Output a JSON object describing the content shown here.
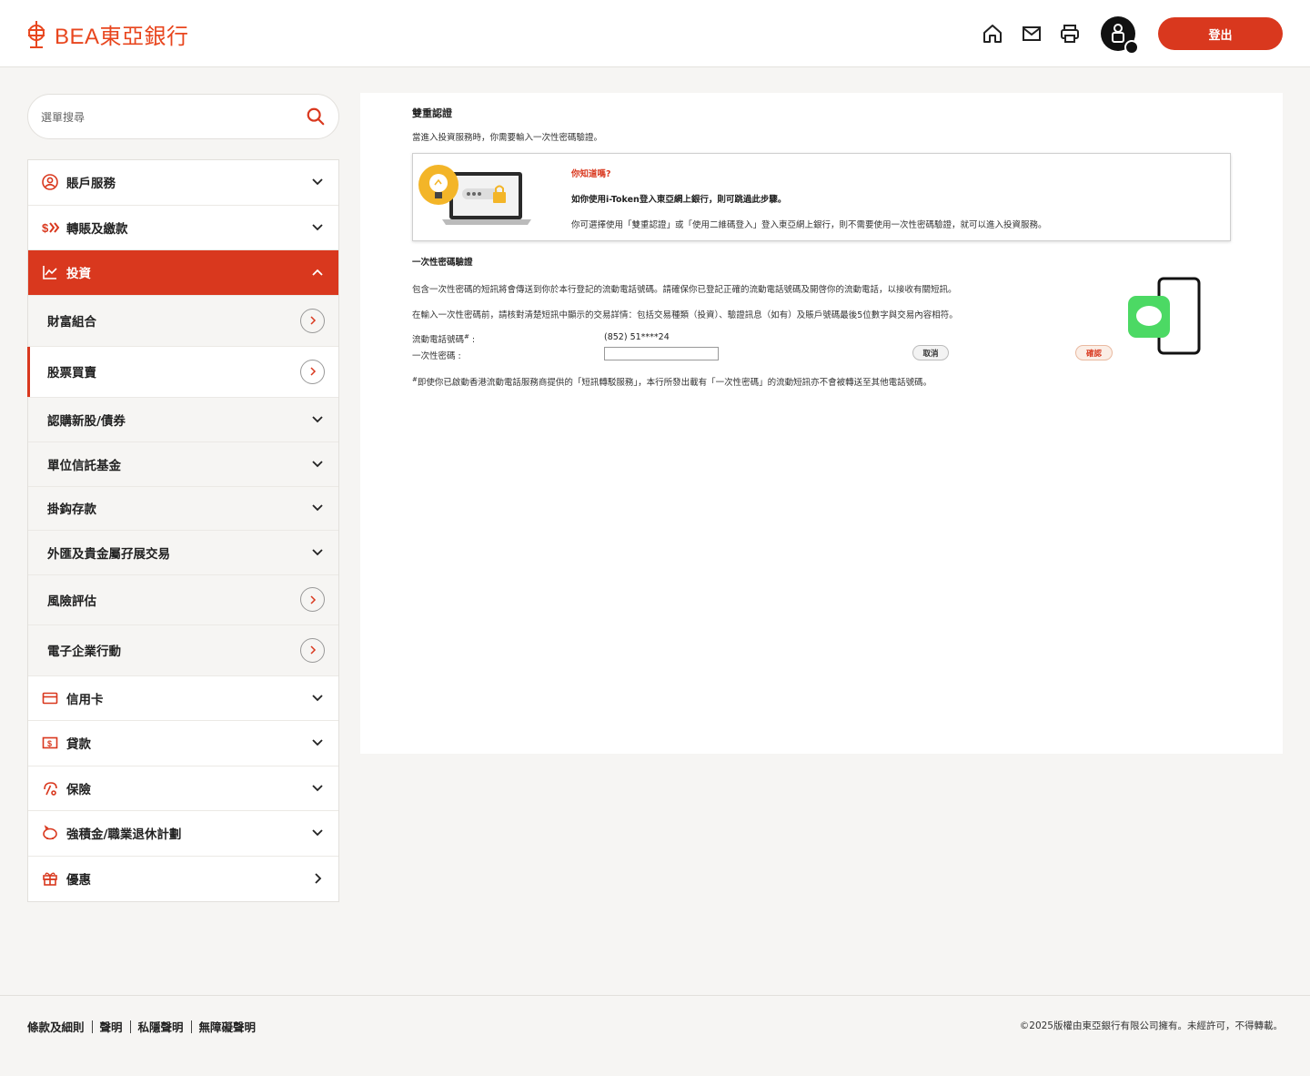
{
  "header": {
    "logo_text": "BEA東亞銀行",
    "logout_label": "登出",
    "brand_color": "#d9381e"
  },
  "sidebar": {
    "search_placeholder": "選單搜尋",
    "items": [
      {
        "label": "賬戶服務",
        "icon": "user-icon",
        "indicator": "chevron-down"
      },
      {
        "label": "轉賬及繳款",
        "icon": "transfer-icon",
        "indicator": "chevron-down"
      },
      {
        "label": "投資",
        "icon": "chart-icon",
        "indicator": "chevron-up",
        "active": true
      }
    ],
    "subitems": [
      {
        "label": "財富組合",
        "indicator": "circle-arrow"
      },
      {
        "label": "股票買賣",
        "indicator": "circle-arrow",
        "selected": true
      },
      {
        "label": "認購新股/債券",
        "indicator": "chevron-down"
      },
      {
        "label": "單位信託基金",
        "indicator": "chevron-down"
      },
      {
        "label": "掛鈎存款",
        "indicator": "chevron-down"
      },
      {
        "label": "外匯及貴金屬孖展交易",
        "indicator": "chevron-down"
      },
      {
        "label": "風險評估",
        "indicator": "circle-arrow"
      },
      {
        "label": "電子企業行動",
        "indicator": "circle-arrow"
      }
    ],
    "items2": [
      {
        "label": "信用卡",
        "icon": "card-icon",
        "indicator": "chevron-down"
      },
      {
        "label": "貸款",
        "icon": "loan-icon",
        "indicator": "chevron-down"
      },
      {
        "label": "保險",
        "icon": "insurance-icon",
        "indicator": "chevron-down"
      },
      {
        "label": "強積金/職業退休計劃",
        "icon": "piggy-icon",
        "indicator": "chevron-down"
      },
      {
        "label": "優惠",
        "icon": "gift-icon",
        "indicator": "chevron-right"
      }
    ]
  },
  "content": {
    "title": "雙重認證",
    "desc": "當進入投資服務時，你需要輸入一次性密碼驗證。",
    "tip": {
      "head": "你知道嗎?",
      "line1": "如你使用i-Token登入東亞網上銀行，則可跳過此步驟。",
      "line2": "你可選擇使用「雙重認證」或「使用二維碼登入」登入東亞網上銀行，則不需要使用一次性密碼驗證，就可以進入投資服務。"
    },
    "otp": {
      "title": "一次性密碼驗證",
      "p1": "包含一次性密碼的短訊將會傳送到你於本行登記的流動電話號碼。請確保你已登記正確的流動電話號碼及開啓你的流動電話，以接收有關短訊。",
      "p2": "在輸入一次性密碼前，請核對清楚短訊中顯示的交易詳情：包括交易種類（投資）、驗證訊息（如有）及賬戶號碼最後5位數字與交易內容相符。",
      "phone_label": "流動電話號碼",
      "phone_mark": "#",
      "phone_value": "(852) 51****24",
      "otp_label": "一次性密碼 :",
      "cancel": "取消",
      "confirm": "確認",
      "note_mark": "#",
      "note": "即使你已啟動香港流動電話服務商提供的「短訊轉駁服務」，本行所發出載有「一次性密碼」的流動短訊亦不會被轉送至其他電話號碼。"
    }
  },
  "footer": {
    "links": [
      "條款及細則",
      "聲明",
      "私隱聲明",
      "無障礙聲明"
    ],
    "copyright": "©2025版權由東亞銀行有限公司擁有。未經許可，不得轉載。"
  }
}
